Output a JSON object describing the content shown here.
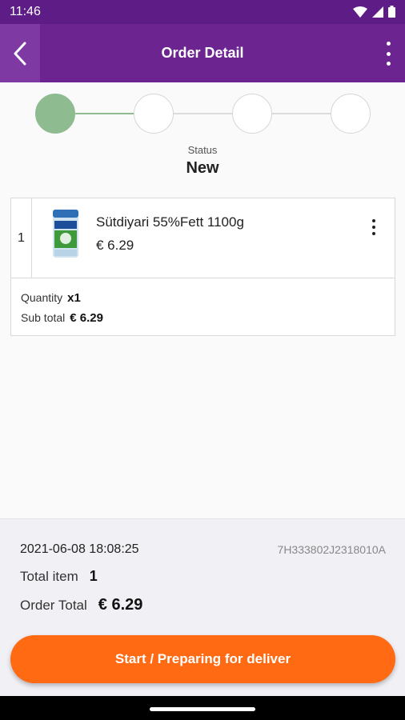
{
  "status_bar": {
    "time": "11:46"
  },
  "app_bar": {
    "title": "Order Detail"
  },
  "stepper": {
    "steps": 4,
    "active_step": 1
  },
  "status": {
    "label": "Status",
    "value": "New"
  },
  "items": [
    {
      "index": "1",
      "name": "Sütdiyari 55%Fett 1100g",
      "price": "€ 6.29",
      "quantity_label": "Quantity",
      "quantity": "x1",
      "subtotal_label": "Sub total",
      "subtotal": "€ 6.29"
    }
  ],
  "summary": {
    "date": "2021-06-08 18:08:25",
    "order_id": "7H333802J2318010A",
    "total_item_label": "Total item",
    "total_item": "1",
    "order_total_label": "Order Total",
    "order_total": "€ 6.29"
  },
  "cta": {
    "label": "Start / Preparing for deliver"
  },
  "colors": {
    "header": "#6c2491",
    "accent": "#ff6a13",
    "step_active": "#8fbb90"
  },
  "icons": [
    "wifi-icon",
    "signal-icon",
    "battery-icon",
    "back-icon",
    "more-vert-icon",
    "product-image"
  ]
}
